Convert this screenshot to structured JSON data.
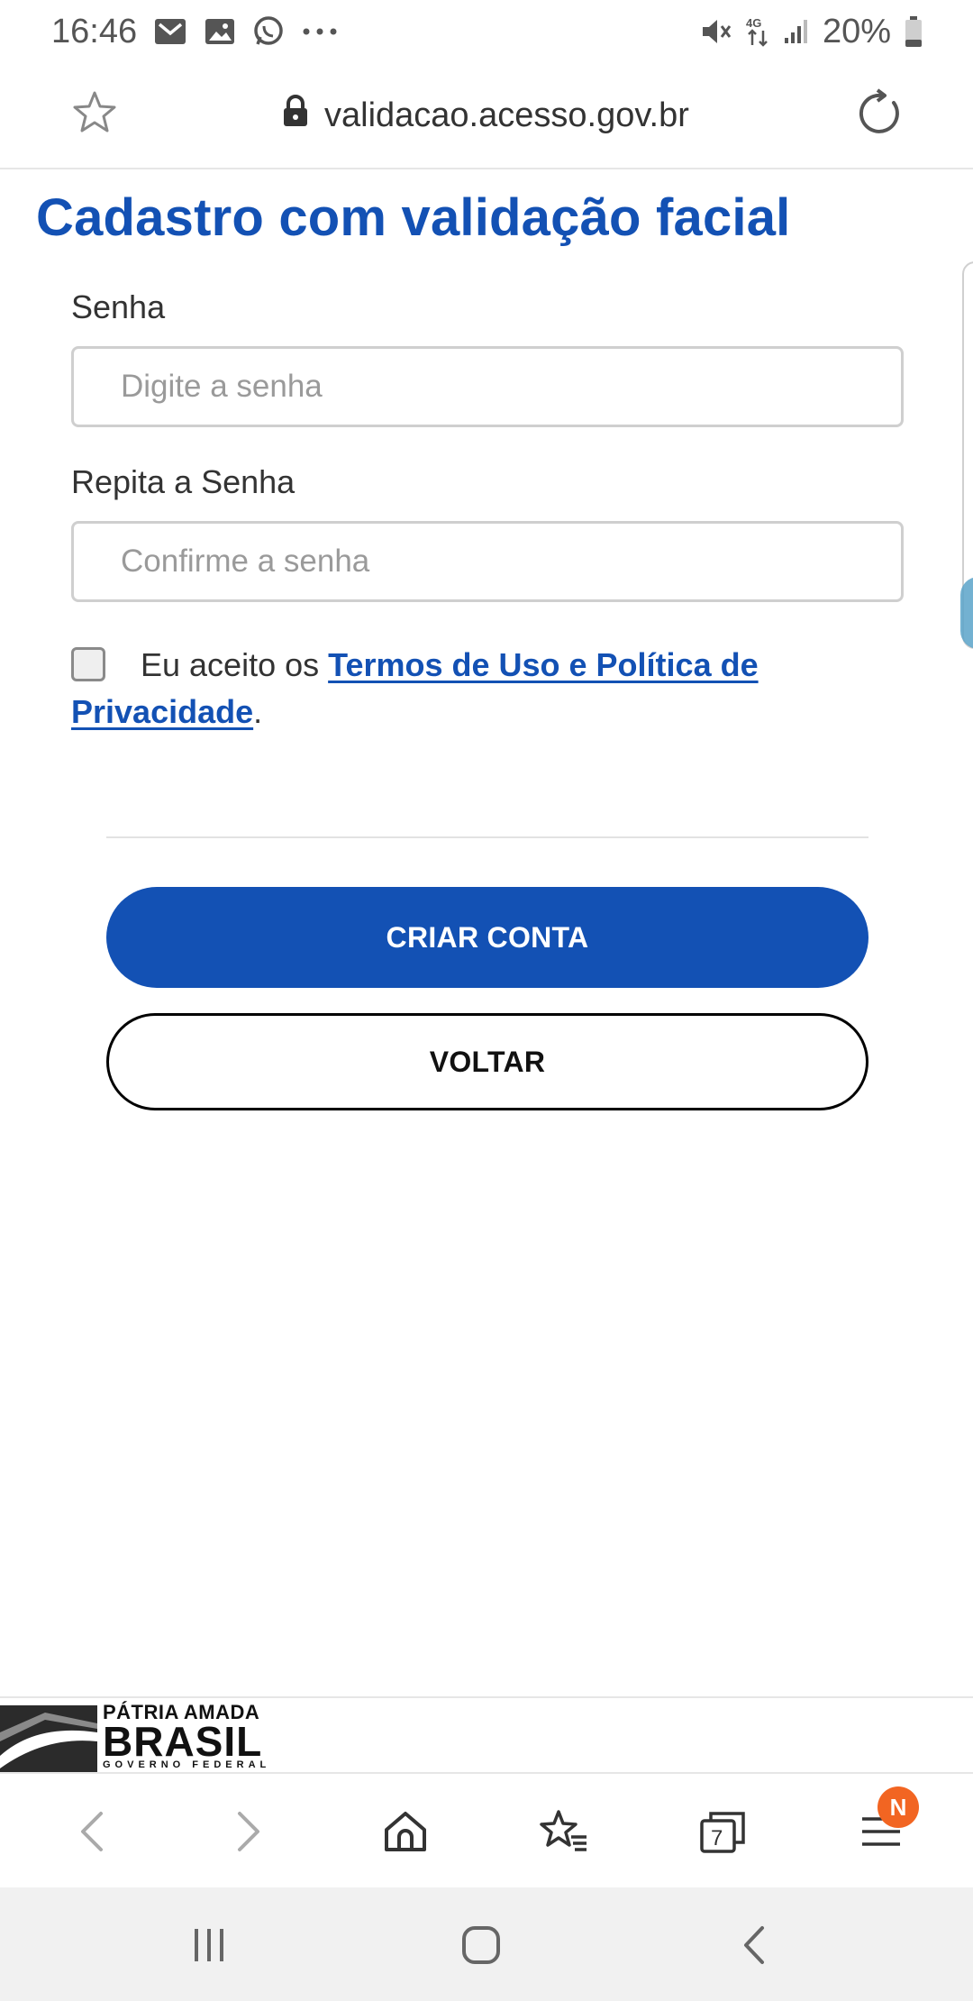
{
  "status_bar": {
    "time": "16:46",
    "battery": "20%",
    "network": "4G"
  },
  "browser": {
    "url": "validacao.acesso.gov.br",
    "tab_count": "7",
    "menu_badge": "N"
  },
  "page": {
    "title": "Cadastro com validação facial",
    "password_label": "Senha",
    "password_placeholder": "Digite a senha",
    "repeat_label": "Repita a Senha",
    "repeat_placeholder": "Confirme a senha",
    "terms_prefix": "Eu aceito os ",
    "terms_link_part1": "Termos de Uso e Política de",
    "terms_link_part2": "Privacidade",
    "terms_suffix": ".",
    "create_button": "CRIAR CONTA",
    "back_button": "VOLTAR"
  },
  "footer": {
    "line1": "PÁTRIA AMADA",
    "line2": "BRASIL",
    "line3": "GOVERNO FEDERAL"
  },
  "colors": {
    "primary": "#1351b4",
    "badge": "#f26522"
  }
}
